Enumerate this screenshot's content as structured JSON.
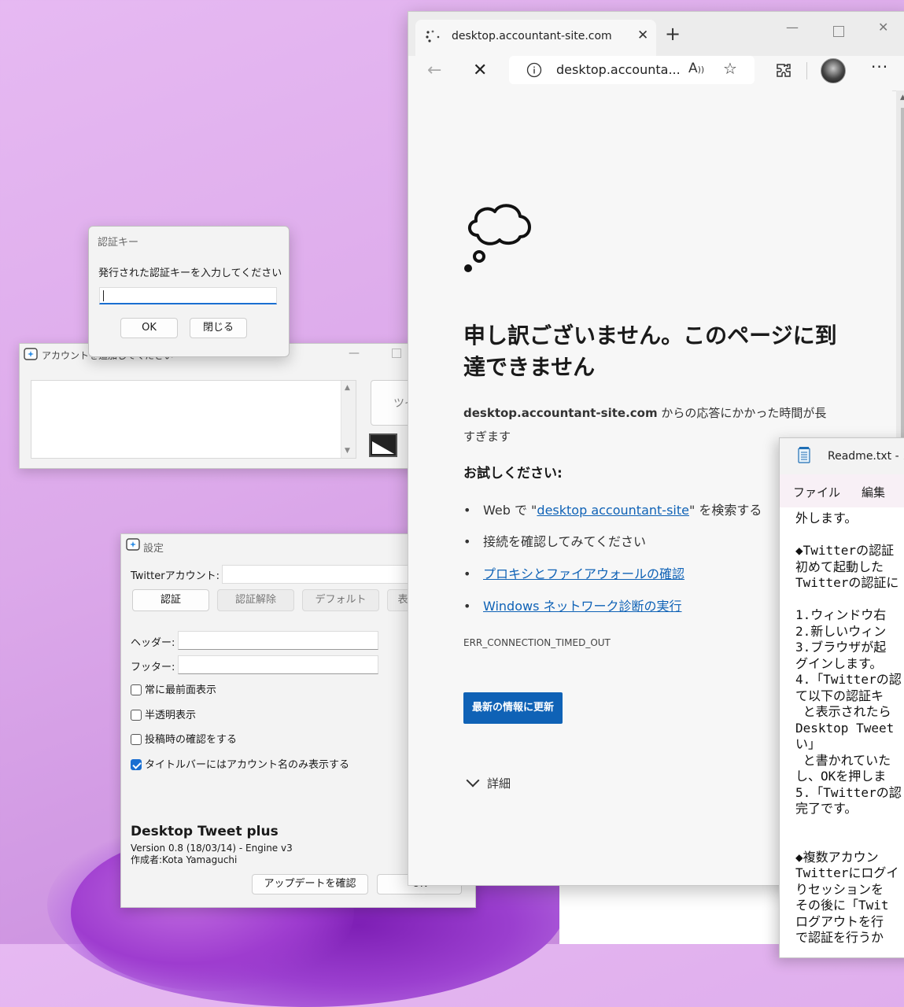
{
  "account_window": {
    "title": "アカウントを追加してください",
    "side_button": "ツイ"
  },
  "auth_dialog": {
    "title": "認証キー",
    "message": "発行された認証キーを入力してください",
    "input_value": "",
    "ok_label": "OK",
    "close_label": "閉じる"
  },
  "settings": {
    "title": "設定",
    "twitter_account_label": "Twitterアカウント:",
    "tabs": [
      "認証",
      "認証解除",
      "デフォルト",
      "表"
    ],
    "header_label": "ヘッダー:",
    "footer_label": "フッター:",
    "checkboxes": [
      {
        "label": "常に最前面表示",
        "checked": false
      },
      {
        "label": "半透明表示",
        "checked": false
      },
      {
        "label": "投稿時の確認をする",
        "checked": false
      },
      {
        "label": "タイトルバーにはアカウント名のみ表示する",
        "checked": true
      }
    ],
    "app_name": "Desktop Tweet plus",
    "version": "Version 0.8 (18/03/14) - Engine v3",
    "author": "作成者:Kota Yamaguchi",
    "update_button": "アップデートを確認",
    "ok_button": "OK"
  },
  "browser": {
    "tab_title": "desktop.accountant-site.com",
    "address": "desktop.accounta...",
    "error_title": "申し訳ございません。このページに到達できません",
    "error_host": "desktop.accountant-site.com",
    "error_desc": " からの応答にかかった時間が長すぎます",
    "try_heading": "お試しください:",
    "try_items": [
      {
        "pre": "Web で \"",
        "link": "desktop accountant-site",
        "post": "\" を検索する"
      },
      {
        "pre": "接続を確認してみてください",
        "link": "",
        "post": ""
      },
      {
        "pre": "",
        "link": "プロキシとファイアウォールの確認",
        "post": ""
      },
      {
        "pre": "",
        "link": "Windows ネットワーク診断の実行",
        "post": ""
      }
    ],
    "error_code": "ERR_CONNECTION_TIMED_OUT",
    "reload_button": "最新の情報に更新",
    "details_label": "詳細"
  },
  "notepad": {
    "title": "Readme.txt - メ",
    "menu": [
      "ファイル",
      "編集"
    ],
    "lines": [
      "外します。",
      "",
      "◆Twitterの認証",
      "初めて起動した",
      "Twitterの認証に",
      "",
      "1.ウィンドウ右",
      "2.新しいウィン",
      "3.ブラウザが起",
      "グインします。",
      "4.「Twitterの認",
      "て以下の認証キ",
      " と表示されたら",
      "Desktop Tweet",
      "い」",
      " と書かれていた",
      "し、OKを押しま",
      "5.「Twitterの認",
      "完了です。",
      "",
      "",
      "◆複数アカウン",
      "Twitterにログイ",
      "りセッションを",
      "その後に「Twit",
      "ログアウトを行",
      "で認証を行うか"
    ]
  }
}
